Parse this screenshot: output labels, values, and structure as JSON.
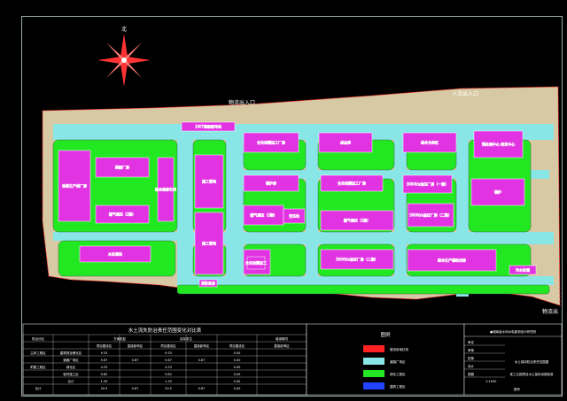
{
  "colors": {
    "background": "#000000",
    "site_ground": "#d7c9a3",
    "road": "#88e6e6",
    "green": "#22e822",
    "building": "#e233e2",
    "red_line": "#ff2222",
    "frame": "#99aaaa"
  },
  "compass": {
    "north_label": "北"
  },
  "site_labels": {
    "logistics_entrance_left": "物流出入口",
    "people_entrance": "人流出入口",
    "logistics_entrance_right": "物流出"
  },
  "buildings": [
    {
      "label": "100T高级配电站"
    },
    {
      "label": "全自动精加工厂房"
    },
    {
      "label": "成品库"
    },
    {
      "label": "综合仓库区"
    },
    {
      "label": "预处理中心\n研发中心"
    },
    {
      "label": "涂装生产线厂房"
    },
    {
      "label": "装配厂房"
    },
    {
      "label": "综合维修车间"
    },
    {
      "label": "锅炉房"
    },
    {
      "label": "全自动精加工厂房"
    },
    {
      "label": "3000t/a油压厂房（一期）"
    },
    {
      "label": "锅炉"
    },
    {
      "label": "施工营地"
    },
    {
      "label": "燃气调压（2期）"
    },
    {
      "label": "燃气调压（3期）"
    },
    {
      "label": "空压站"
    },
    {
      "label": "燃气调压（2期）"
    },
    {
      "label": "5000t/a油压厂房（二期）"
    },
    {
      "label": "水处理站"
    },
    {
      "label": "施工营地"
    },
    {
      "label": "施工营地"
    },
    {
      "label": "全自动精加工"
    },
    {
      "label": "5000t/a油压厂房（二期）"
    },
    {
      "label": "综合生产辅助用房"
    },
    {
      "label": "污水处理"
    },
    {
      "label": "消防泵房"
    }
  ],
  "table": {
    "title": "水土流失防治责任范围变化对比表",
    "headers": [
      "防治分区",
      "",
      "方案批复",
      "",
      "实际发生",
      "",
      "增减情况"
    ],
    "subheaders": [
      "",
      "",
      "项目建设区",
      "直接影响区",
      "项目建设区",
      "直接影响区",
      "项目建设区",
      "直接影响区"
    ],
    "rows": [
      [
        "主体工程区",
        "建筑物及硬化区",
        "9.33",
        "",
        "9.33",
        "",
        "0.00",
        ""
      ],
      [
        "",
        "道路广场区",
        "5.67",
        "0.67",
        "5.67",
        "0.67",
        "0.00",
        ""
      ],
      [
        "附属工程区",
        "绿化区",
        "4.33",
        "",
        "4.33",
        "",
        "0.00",
        ""
      ],
      [
        "",
        "临时施工区",
        "0.82",
        "",
        "0.82",
        "",
        "0.00",
        ""
      ],
      [
        "",
        "合计",
        "1.35",
        "",
        "1.35",
        "",
        "0.00",
        ""
      ],
      [
        "合计",
        "",
        "20.5",
        "0.67",
        "20.5",
        "0.67",
        "0.00",
        ""
      ]
    ]
  },
  "legend": {
    "title": "图例",
    "items": [
      {
        "label": "建设用地红线",
        "color": "#ff2222"
      },
      {
        "label": "道路广场区",
        "color": "#88e6e6"
      },
      {
        "label": "绿化工程区",
        "color": "#22e822"
      },
      {
        "label": "建筑工程区",
        "color": "#2244ff"
      }
    ]
  },
  "titleblock": {
    "company": "●湖南省水利水电勘测设计研究院",
    "rows": [
      "审定",
      "审核",
      "校核",
      "设计",
      "制图"
    ],
    "drawing_title": "水土保持防治责任范围图",
    "project": "某工业园项目水土保持设施验收",
    "scale": "1:1000",
    "drawing_no": "图号"
  }
}
